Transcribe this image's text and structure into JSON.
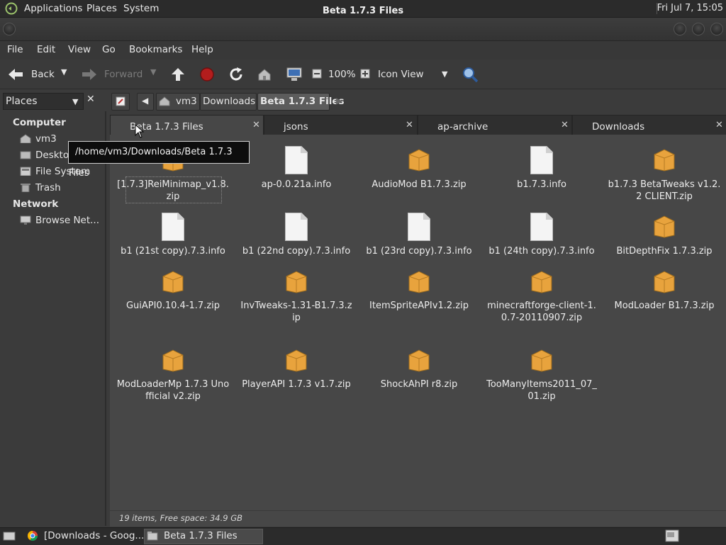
{
  "top_panel": {
    "menus": [
      "Applications",
      "Places",
      "System"
    ],
    "clock": "Fri Jul  7, 15:05"
  },
  "window": {
    "title": "Beta 1.7.3 Files"
  },
  "menubar": [
    "File",
    "Edit",
    "View",
    "Go",
    "Bookmarks",
    "Help"
  ],
  "toolbar": {
    "back": "Back",
    "forward": "Forward",
    "zoom": "100%",
    "view_mode": "Icon View"
  },
  "places": {
    "header": "Places",
    "sections": [
      {
        "title": "Computer",
        "items": [
          "vm3",
          "Desktop",
          "File System",
          "Trash"
        ]
      },
      {
        "title": "Network",
        "items": [
          "Browse Net..."
        ]
      }
    ]
  },
  "pathbar": [
    "vm3",
    "Downloads",
    "Beta 1.7.3 Files"
  ],
  "tabs": [
    {
      "label": "Beta 1.7.3 Files",
      "active": true
    },
    {
      "label": "jsons",
      "active": false
    },
    {
      "label": "ap-archive",
      "active": false
    },
    {
      "label": "Downloads",
      "active": false
    }
  ],
  "tooltip": "/home/vm3/Downloads/Beta 1.7.3 Files",
  "files": [
    {
      "name": "[1.7.3]ReiMinimap_v1.8.zip",
      "kind": "zip"
    },
    {
      "name": "ap-0.0.21a.info",
      "kind": "doc"
    },
    {
      "name": "AudioMod B1.7.3.zip",
      "kind": "zip"
    },
    {
      "name": "b1.7.3.info",
      "kind": "doc"
    },
    {
      "name": "b1.7.3 BetaTweaks v1.2.2 CLIENT.zip",
      "kind": "zip"
    },
    {
      "name": "b1 (21st copy).7.3.info",
      "kind": "doc"
    },
    {
      "name": "b1 (22nd copy).7.3.info",
      "kind": "doc"
    },
    {
      "name": "b1 (23rd copy).7.3.info",
      "kind": "doc"
    },
    {
      "name": "b1 (24th copy).7.3.info",
      "kind": "doc"
    },
    {
      "name": "BitDepthFix 1.7.3.zip",
      "kind": "zip"
    },
    {
      "name": "GuiAPI0.10.4-1.7.zip",
      "kind": "zip"
    },
    {
      "name": "InvTweaks-1.31-B1.7.3.zip",
      "kind": "zip"
    },
    {
      "name": "ItemSpriteAPIv1.2.zip",
      "kind": "zip"
    },
    {
      "name": "minecraftforge-client-1.0.7-20110907.zip",
      "kind": "zip"
    },
    {
      "name": "ModLoader B1.7.3.zip",
      "kind": "zip"
    },
    {
      "name": "ModLoaderMp 1.7.3 Unofficial v2.zip",
      "kind": "zip"
    },
    {
      "name": "PlayerAPI 1.7.3 v1.7.zip",
      "kind": "zip"
    },
    {
      "name": "ShockAhPI r8.zip",
      "kind": "zip"
    },
    {
      "name": "TooManyItems2011_07_01.zip",
      "kind": "zip"
    }
  ],
  "status": "19 items, Free space: 34.9 GB",
  "taskbar": [
    {
      "label": "[Downloads - Goog..."
    },
    {
      "label": "Beta 1.7.3 Files"
    }
  ],
  "colors": {
    "folder": "#e8a33d",
    "active_task": "#4a4a4a"
  }
}
